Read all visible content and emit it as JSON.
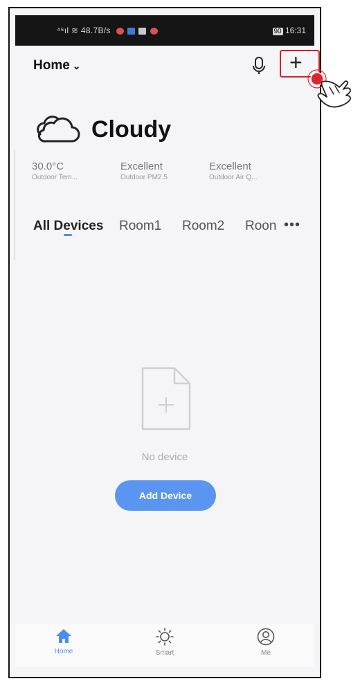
{
  "status_bar": {
    "left_text": "⁴⁶ıl ≋ 48.7B/s",
    "time": "16:31",
    "battery": "90"
  },
  "header": {
    "home_label": "Home",
    "chevron": "⌄",
    "mic_icon": "microphone-icon",
    "add_icon": "plus-icon"
  },
  "weather": {
    "icon": "cloud-icon",
    "condition": "Cloudy",
    "stats": [
      {
        "value": "30.0°C",
        "label": "Outdoor Tem..."
      },
      {
        "value": "Excellent",
        "label": "Outdoor PM2.5"
      },
      {
        "value": "Excellent",
        "label": "Outdoor Air Q..."
      }
    ]
  },
  "tabs": {
    "items": [
      "All Devices",
      "Room1",
      "Room2",
      "Roon"
    ],
    "active_index": 0,
    "more": "•••"
  },
  "empty_state": {
    "icon": "add-document-icon",
    "message": "No device",
    "button": "Add Device"
  },
  "bottom_nav": [
    {
      "label": "Home",
      "icon": "home-icon",
      "active": true
    },
    {
      "label": "Smart",
      "icon": "sun-icon",
      "active": false
    },
    {
      "label": "Me",
      "icon": "user-circle-icon",
      "active": false
    }
  ],
  "colors": {
    "accent": "#5b95f2",
    "highlight": "#d0202a",
    "background": "#f5f5f7"
  },
  "annotation": {
    "icon": "pointing-hand-icon"
  }
}
